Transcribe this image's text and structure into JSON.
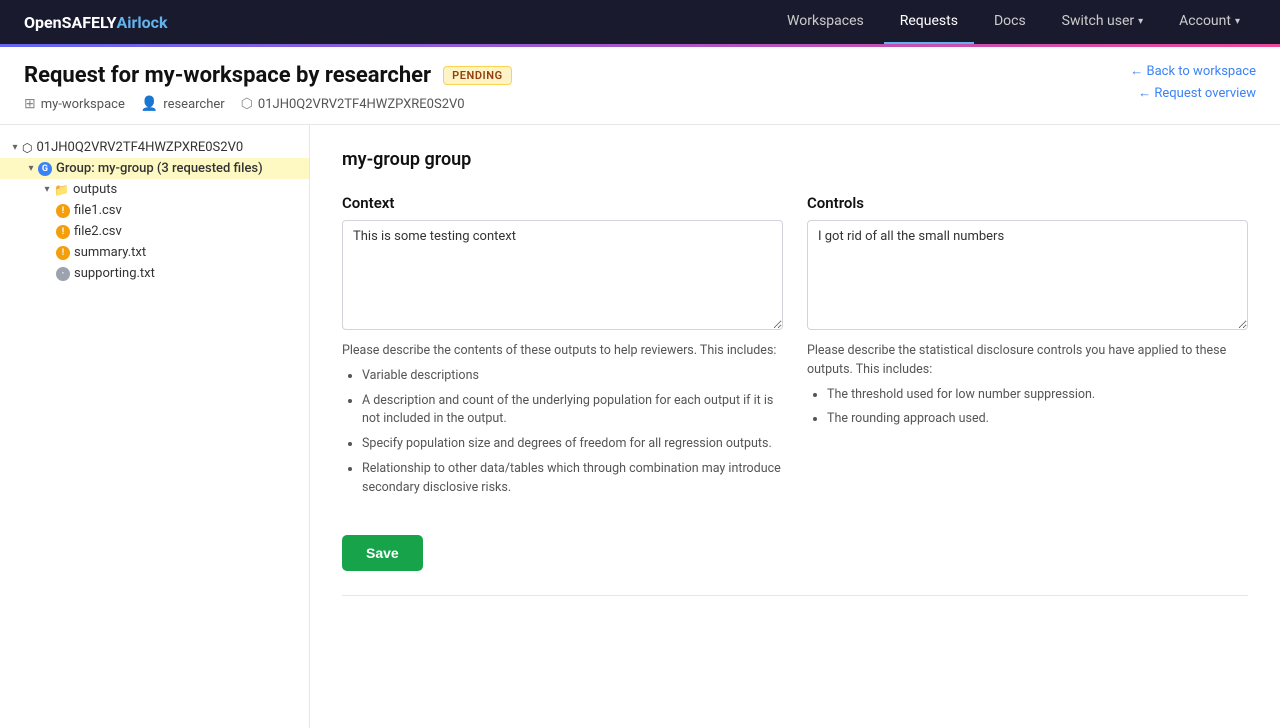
{
  "brand": {
    "open": "Open",
    "safely": "SAFELY ",
    "airlock": "Airlock"
  },
  "nav": {
    "workspaces": "Workspaces",
    "requests": "Requests",
    "docs": "Docs",
    "switch_user": "Switch user",
    "account": "Account"
  },
  "header": {
    "title": "Request for my-workspace by researcher",
    "status": "PENDING",
    "workspace": "my-workspace",
    "user": "researcher",
    "request_id": "01JH0Q2VRV2TF4HWZPXRE0S2V0",
    "back_link": "← Back to workspace",
    "overview_link": "← Request overview"
  },
  "sidebar": {
    "root_id": "01JH0Q2VRV2TF4HWZPXRE0S2V0",
    "group_label": "Group: my-group (3 requested files)",
    "outputs_label": "outputs",
    "files": [
      {
        "name": "file1.csv",
        "badge": "orange"
      },
      {
        "name": "file2.csv",
        "badge": "orange"
      },
      {
        "name": "summary.txt",
        "badge": "orange"
      },
      {
        "name": "supporting.txt",
        "badge": "gray"
      }
    ]
  },
  "main": {
    "group_title": "my-group group",
    "context": {
      "label": "Context",
      "value": "This is some testing context",
      "hint_intro": "Please describe the contents of these outputs to help reviewers. This includes:",
      "hints": [
        "Variable descriptions",
        "A description and count of the underlying population for each output if it is not included in the output.",
        "Specify population size and degrees of freedom for all regression outputs.",
        "Relationship to other data/tables which through combination may introduce secondary disclosive risks."
      ]
    },
    "controls": {
      "label": "Controls",
      "value": "I got rid of all the small numbers",
      "hint_intro": "Please describe the statistical disclosure controls you have applied to these outputs. This includes:",
      "hints": [
        "The threshold used for low number suppression.",
        "The rounding approach used."
      ]
    },
    "save_button": "Save"
  }
}
